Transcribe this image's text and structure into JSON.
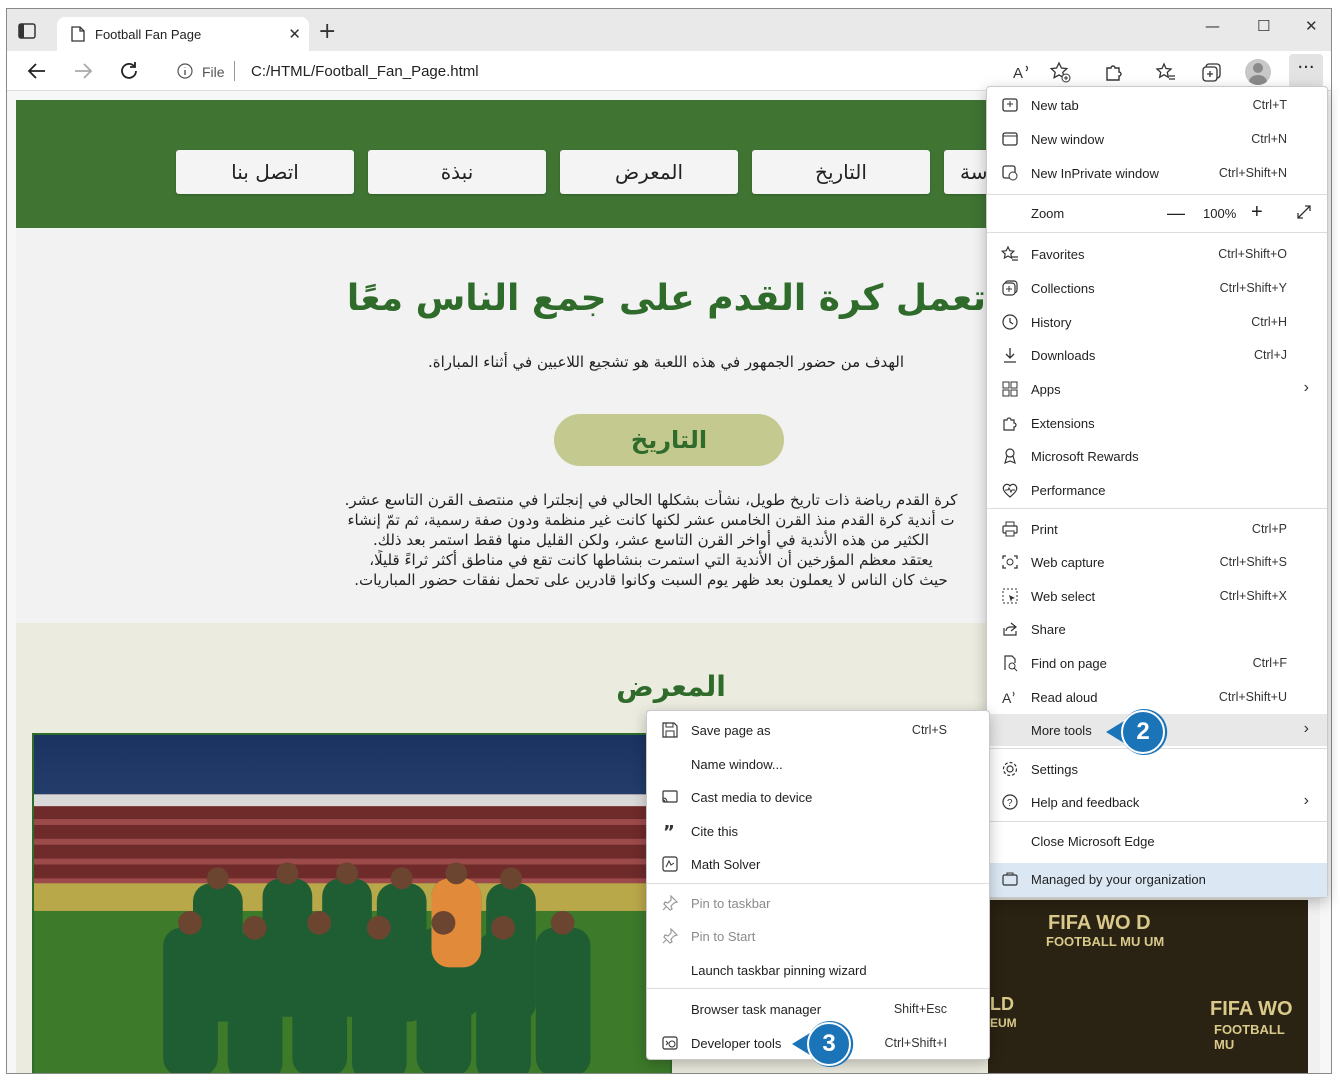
{
  "browser": {
    "tab_title": "Football Fan Page",
    "address_scheme": "File",
    "address_url": "C:/HTML/Football_Fan_Page.html"
  },
  "site": {
    "nav": [
      "اتصل بنا",
      "نبذة",
      "المعرض",
      "التاريخ",
      "سة"
    ],
    "hero_title": "تعمل كرة القدم على جمع الناس معًا",
    "hero_sub": "الهدف من حضور الجمهور في هذه اللعبة هو تشجيع اللاعبين في أثناء المباراة.",
    "history_button": "التاريخ",
    "history_lines": [
      "كرة القدم رياضة ذات تاريخ طويل، نشأت بشكلها الحالي في إنجلترا في منتصف القرن التاسع عشر.",
      "ت أندية كرة القدم منذ القرن الخامس عشر لكنها كانت غير منظمة ودون صفة رسمية، ثم تمّ إنشاء",
      "الكثير من هذه الأندية في أواخر القرن التاسع عشر، ولكن القليل منها فقط استمر بعد ذلك.",
      "يعتقد معظم المؤرخين أن الأندية التي استمرت بنشاطها كانت تقع في مناطق أكثر ثراءً قليلًا،",
      "حيث كان الناس لا يعملون بعد ظهر يوم السبت وكانوا قادرين على تحمل نفقات حضور المباريات."
    ],
    "gallery_title": "المعرض",
    "photo2_text": [
      "FIFA WO D",
      "FOOTBALL MU UM",
      "LD",
      "EUM",
      "FIFA WO",
      "FOOTBALL MU"
    ]
  },
  "menu": {
    "items": [
      {
        "icon": "new-tab-icon",
        "label": "New tab",
        "shortcut": "Ctrl+T"
      },
      {
        "icon": "new-window-icon",
        "label": "New window",
        "shortcut": "Ctrl+N"
      },
      {
        "icon": "inprivate-icon",
        "label": "New InPrivate window",
        "shortcut": "Ctrl+Shift+N"
      },
      {
        "icon": "favorites-icon",
        "label": "Favorites",
        "shortcut": "Ctrl+Shift+O"
      },
      {
        "icon": "collections-icon",
        "label": "Collections",
        "shortcut": "Ctrl+Shift+Y"
      },
      {
        "icon": "history-icon",
        "label": "History",
        "shortcut": "Ctrl+H"
      },
      {
        "icon": "downloads-icon",
        "label": "Downloads",
        "shortcut": "Ctrl+J"
      },
      {
        "icon": "apps-icon",
        "label": "Apps",
        "shortcut": ""
      },
      {
        "icon": "extensions-icon",
        "label": "Extensions",
        "shortcut": ""
      },
      {
        "icon": "rewards-icon",
        "label": "Microsoft Rewards",
        "shortcut": ""
      },
      {
        "icon": "performance-icon",
        "label": "Performance",
        "shortcut": ""
      },
      {
        "icon": "print-icon",
        "label": "Print",
        "shortcut": "Ctrl+P"
      },
      {
        "icon": "web-capture-icon",
        "label": "Web capture",
        "shortcut": "Ctrl+Shift+S"
      },
      {
        "icon": "web-select-icon",
        "label": "Web select",
        "shortcut": "Ctrl+Shift+X"
      },
      {
        "icon": "share-icon",
        "label": "Share",
        "shortcut": ""
      },
      {
        "icon": "find-icon",
        "label": "Find on page",
        "shortcut": "Ctrl+F"
      },
      {
        "icon": "read-aloud-icon",
        "label": "Read aloud",
        "shortcut": "Ctrl+Shift+U"
      },
      {
        "icon": "",
        "label": "More tools",
        "shortcut": ""
      },
      {
        "icon": "settings-icon",
        "label": "Settings",
        "shortcut": ""
      },
      {
        "icon": "help-icon",
        "label": "Help and feedback",
        "shortcut": ""
      },
      {
        "icon": "",
        "label": "Close Microsoft Edge",
        "shortcut": ""
      },
      {
        "icon": "briefcase-icon",
        "label": "Managed by your organization",
        "shortcut": ""
      }
    ],
    "zoom_label": "Zoom",
    "zoom_value": "100%"
  },
  "submenu": {
    "items": [
      {
        "icon": "save-icon",
        "label": "Save page as",
        "shortcut": "Ctrl+S",
        "disabled": false
      },
      {
        "icon": "",
        "label": "Name window...",
        "shortcut": "",
        "disabled": false
      },
      {
        "icon": "cast-icon",
        "label": "Cast media to device",
        "shortcut": "",
        "disabled": false
      },
      {
        "icon": "quote-icon",
        "label": "Cite this",
        "shortcut": "",
        "disabled": false
      },
      {
        "icon": "math-icon",
        "label": "Math Solver",
        "shortcut": "",
        "disabled": false
      },
      {
        "icon": "pin-icon",
        "label": "Pin to taskbar",
        "shortcut": "",
        "disabled": true
      },
      {
        "icon": "pin-icon",
        "label": "Pin to Start",
        "shortcut": "",
        "disabled": true
      },
      {
        "icon": "",
        "label": "Launch taskbar pinning wizard",
        "shortcut": "",
        "disabled": false
      },
      {
        "icon": "",
        "label": "Browser task manager",
        "shortcut": "Shift+Esc",
        "disabled": false
      },
      {
        "icon": "devtools-icon",
        "label": "Developer tools",
        "shortcut": "Ctrl+Shift+I",
        "disabled": false
      }
    ]
  },
  "callouts": [
    "2",
    "3"
  ],
  "colors": {
    "site_green": "#3f7433",
    "title_green": "#2f6b2b",
    "history_button": "#c3c98f",
    "callout_blue": "#1b74b8",
    "managed_highlight": "#dbe8f4"
  }
}
